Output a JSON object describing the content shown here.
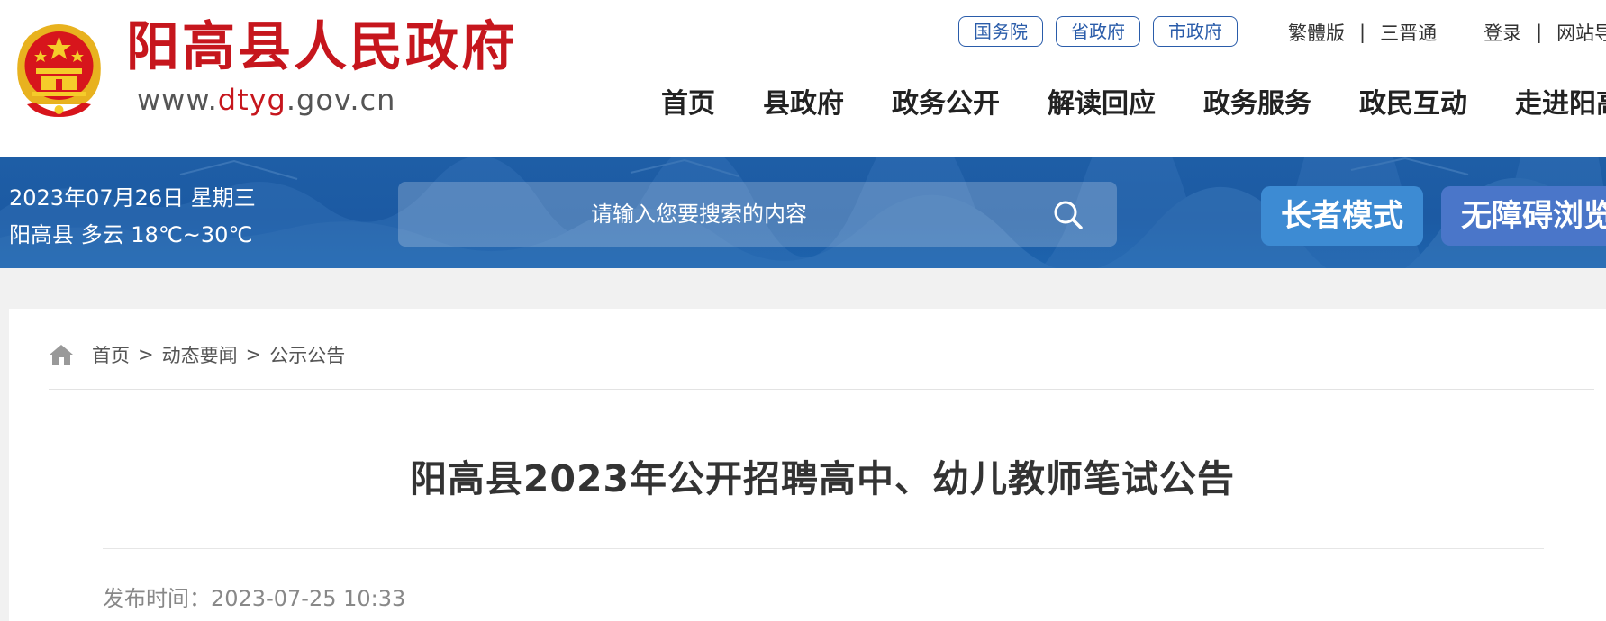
{
  "site": {
    "title": "阳高县人民政府",
    "domain_prefix": "www.",
    "domain_highlight": "dtyg",
    "domain_suffix": ".gov.cn"
  },
  "gov_links": [
    "国务院",
    "省政府",
    "市政府"
  ],
  "util_links": {
    "traditional": "繁體版",
    "sanjin": "三晋通",
    "login": "登录",
    "site_nav": "网站导"
  },
  "main_nav": [
    "首页",
    "县政府",
    "政务公开",
    "解读回应",
    "政务服务",
    "政民互动",
    "走进阳高"
  ],
  "banner": {
    "date": "2023年07月26日 星期三",
    "weather": "阳高县 多云 18℃~30℃",
    "search_placeholder": "请输入您要搜索的内容",
    "elder_mode": "长者模式",
    "accessible_mode": "无障碍浏览"
  },
  "breadcrumb": [
    "首页",
    "动态要闻",
    "公示公告"
  ],
  "breadcrumb_separator": ">",
  "article": {
    "title": "阳高县2023年公开招聘高中、幼儿教师笔试公告",
    "publish_label": "发布时间：",
    "publish_time": "2023-07-25 10:33"
  },
  "colors": {
    "brand_red": "#c6161d",
    "banner_blue": "#1d5ea8",
    "link_blue": "#2a5caa"
  }
}
